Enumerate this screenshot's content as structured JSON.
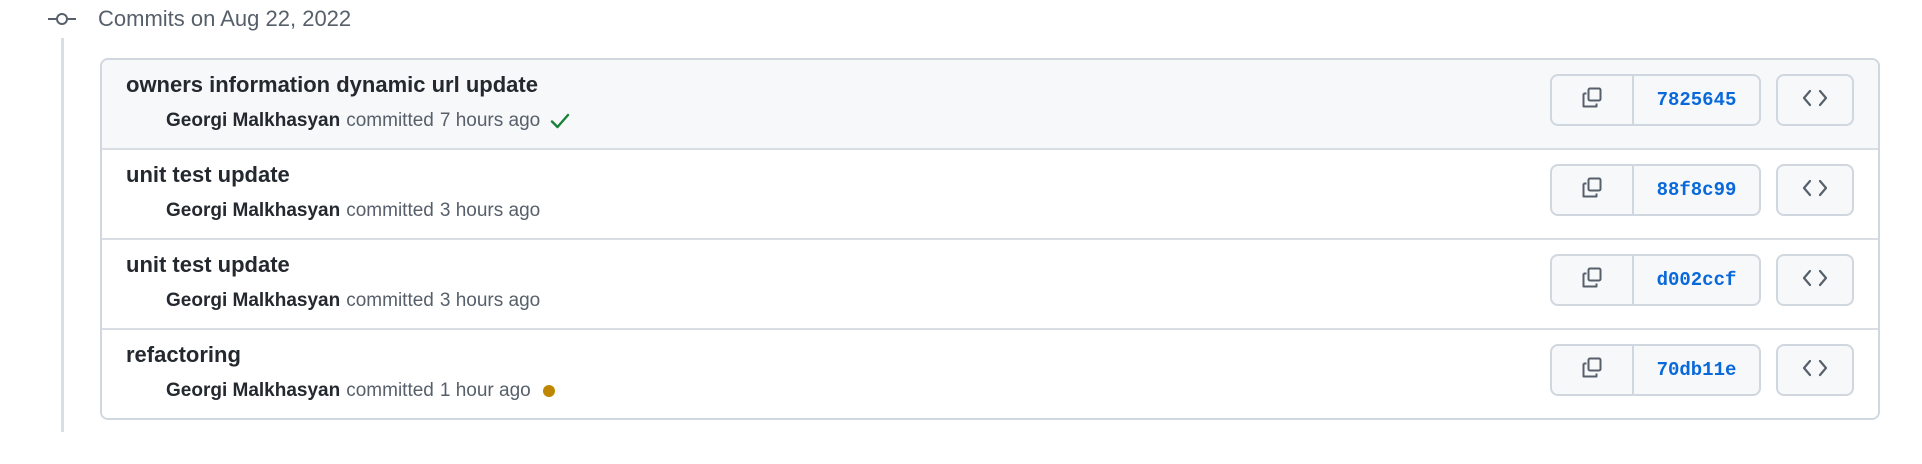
{
  "timeline": {
    "title": "Commits on Aug 22, 2022",
    "icon": "git-commit-icon"
  },
  "colors": {
    "success": "#1a7f37",
    "pending": "#bf8700",
    "link": "#0969da",
    "muted": "#57606a"
  },
  "commits": [
    {
      "message": "owners information dynamic url update",
      "author": "Georgi Malkhasyan",
      "committed_label": "committed",
      "time": "7 hours ago",
      "status": "success",
      "sha": "7825645",
      "copy_icon": "copy-icon",
      "browse_icon": "code-icon"
    },
    {
      "message": "unit test update",
      "author": "Georgi Malkhasyan",
      "committed_label": "committed",
      "time": "3 hours ago",
      "status": "none",
      "sha": "88f8c99",
      "copy_icon": "copy-icon",
      "browse_icon": "code-icon"
    },
    {
      "message": "unit test update",
      "author": "Georgi Malkhasyan",
      "committed_label": "committed",
      "time": "3 hours ago",
      "status": "none",
      "sha": "d002ccf",
      "copy_icon": "copy-icon",
      "browse_icon": "code-icon"
    },
    {
      "message": "refactoring",
      "author": "Georgi Malkhasyan",
      "committed_label": "committed",
      "time": "1 hour ago",
      "status": "pending",
      "sha": "70db11e",
      "copy_icon": "copy-icon",
      "browse_icon": "code-icon"
    }
  ]
}
